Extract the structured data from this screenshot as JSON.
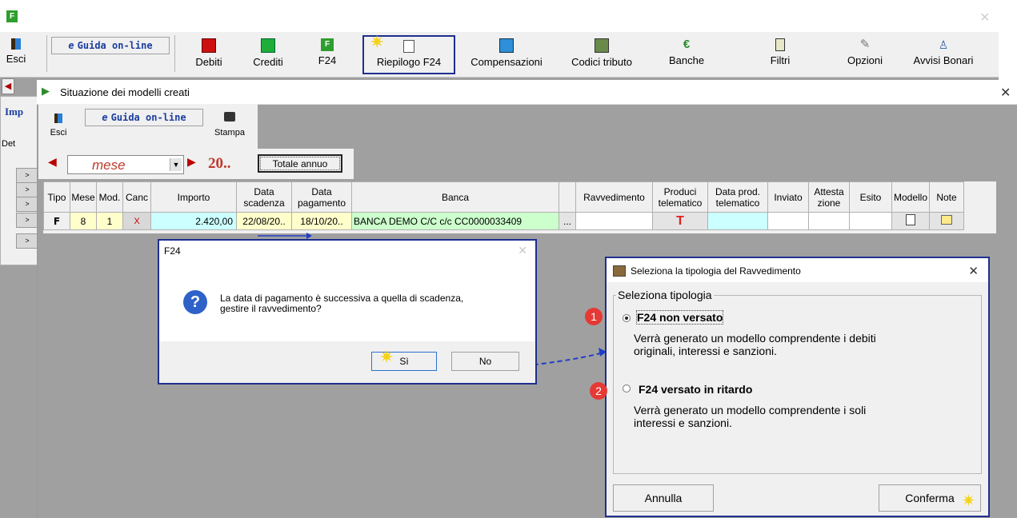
{
  "main_toolbar": {
    "esci": "Esci",
    "guida": "Guida on-line",
    "debiti": "Debiti",
    "crediti": "Crediti",
    "f24": "F24",
    "riepilogo": "Riepilogo F24",
    "compensazioni": "Compensazioni",
    "codici": "Codici tributo",
    "banche": "Banche",
    "filtri": "Filtri",
    "opzioni": "Opzioni",
    "avvisi": "Avvisi Bonari"
  },
  "side": {
    "imp": "Imp",
    "det": "Det"
  },
  "window": {
    "title": "Situazione dei modelli creati",
    "esci": "Esci",
    "guida": "Guida on-line",
    "stampa": "Stampa",
    "month_value": "mese",
    "year_value": "20..",
    "totale_annuo": "Totale annuo"
  },
  "table": {
    "headers": {
      "tipo": "Tipo",
      "mese": "Mese",
      "mod": "Mod.",
      "canc": "Canc",
      "importo": "Importo",
      "scad1": "Data",
      "scad2": "scadenza",
      "pag1": "Data",
      "pag2": "pagamento",
      "banca": "Banca",
      "ravv": "Ravvedimento",
      "prod1": "Produci",
      "prod2": "telematico",
      "dataprod1": "Data prod.",
      "dataprod2": "telematico",
      "inviato": "Inviato",
      "att1": "Attesta",
      "att2": "zione",
      "esito": "Esito",
      "modello": "Modello",
      "note": "Note"
    },
    "row": {
      "tipo": "F",
      "mese": "8",
      "mod": "1",
      "canc": "X",
      "importo": "2.420,00",
      "scadenza": "22/08/20..",
      "pagamento": "18/10/20..",
      "banca": "BANCA DEMO C/C c/c CC0000033409",
      "more": "..."
    }
  },
  "f24_dialog": {
    "title": "F24",
    "message_line1": "La data di pagamento è successiva a quella di scadenza,",
    "message_line2": "gestire il ravvedimento?",
    "si": "Sì",
    "no": "No"
  },
  "ravv_dialog": {
    "title": "Seleziona la tipologia del Ravvedimento",
    "group": "Seleziona tipologia",
    "opt1_label": "F24 non versato",
    "opt1_desc1": "Verrà generato un modello comprendente i debiti",
    "opt1_desc2": "originali, interessi e sanzioni.",
    "opt2_label": "F24 versato in ritardo",
    "opt2_desc1": "Verrà generato un modello comprendente i soli",
    "opt2_desc2": "interessi e sanzioni.",
    "annulla": "Annulla",
    "conferma": "Conferma",
    "badge1": "1",
    "badge2": "2"
  },
  "colors": {
    "highlight_border": "#1f2f8f",
    "green_cell": "#ccffcc",
    "yellow_cell": "#ffffcc",
    "cyan_cell": "#ccffff",
    "badge": "#e53935"
  }
}
